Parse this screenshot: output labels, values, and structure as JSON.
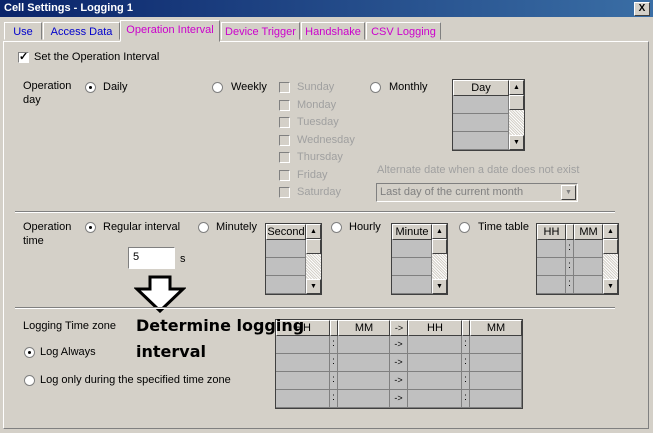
{
  "window": {
    "title": "Cell Settings - Logging 1",
    "close_glyph": "X"
  },
  "tabs": [
    {
      "label": "Use",
      "color": "#0000cc"
    },
    {
      "label": "Access Data",
      "color": "#0000cc"
    },
    {
      "label": "Operation Interval",
      "color": "#cc00cc"
    },
    {
      "label": "Device Trigger",
      "color": "#cc00cc"
    },
    {
      "label": "Handshake",
      "color": "#cc00cc"
    },
    {
      "label": "CSV Logging",
      "color": "#cc00cc"
    }
  ],
  "set_interval": {
    "label": "Set the Operation Interval",
    "checked": true
  },
  "operation_day": {
    "label_line1": "Operation",
    "label_line2": "day",
    "daily": "Daily",
    "weekly": "Weekly",
    "monthly": "Monthly",
    "selected": "daily",
    "weekdays": [
      "Sunday",
      "Monday",
      "Tuesday",
      "Wednesday",
      "Thursday",
      "Friday",
      "Saturday"
    ],
    "day_grid_header": "Day",
    "alternate_label": "Alternate date when a date does not exist",
    "alternate_value": "Last day of the current month"
  },
  "operation_time": {
    "label_line1": "Operation",
    "label_line2": "time",
    "regular": "Regular interval",
    "minutely": "Minutely",
    "hourly": "Hourly",
    "time_table": "Time table",
    "selected": "regular",
    "interval_value": "5",
    "interval_unit": "s",
    "second_header": "Second",
    "minute_header": "Minute",
    "hh": "HH",
    "mm": "MM",
    "colon": ":"
  },
  "logging_zone": {
    "label": "Logging Time zone",
    "always": "Log Always",
    "specified": "Log only during the specified time zone",
    "selected": "always",
    "headers": [
      "HH",
      "MM",
      "->",
      "HH",
      "MM"
    ],
    "arrow": "->",
    "colon": ":"
  },
  "annotation": {
    "line1": "Determine logging",
    "line2": "interval"
  }
}
